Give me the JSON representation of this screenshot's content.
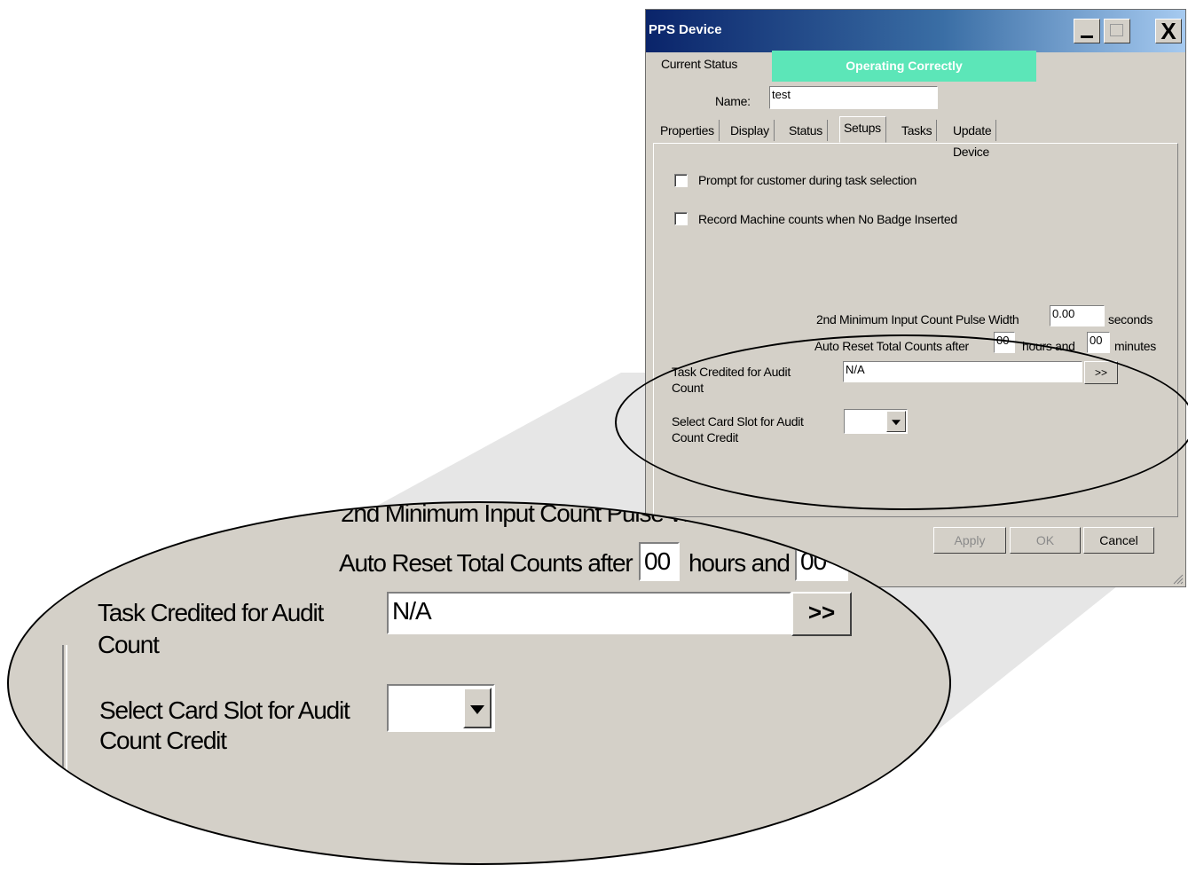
{
  "window": {
    "title": "PPS Device",
    "close_glyph": "X"
  },
  "status": {
    "label": "Current Status",
    "value": "Operating Correctly",
    "color": "#5ce6b8"
  },
  "name_field": {
    "label": "Name:",
    "value": "test"
  },
  "tabs": [
    "Properties",
    "Display",
    "Status",
    "Setups",
    "Tasks",
    "Update Device"
  ],
  "active_tab": "Setups",
  "setups": {
    "checkbox1": "Prompt for customer during task selection",
    "checkbox2": "Record Machine counts when No Badge Inserted",
    "pulse_label": "2nd Minimum Input Count Pulse Width",
    "pulse_value": "0.00",
    "pulse_unit": "seconds",
    "auto_reset_label": "Auto Reset Total Counts after",
    "hours_value": "00",
    "hours_label": "hours and",
    "minutes_value": "00",
    "minutes_label": "minutes",
    "task_label_line1": "Task Credited for Audit",
    "task_label_line2": "Count",
    "task_value": "N/A",
    "browse_label": ">>",
    "slot_label_line1": "Select Card Slot for Audit",
    "slot_label_line2": "Count Credit"
  },
  "buttons": {
    "apply": "Apply",
    "ok": "OK",
    "cancel": "Cancel"
  },
  "zoom": {
    "pulse_label_partial": "2nd Minimum Input Count Pulse W",
    "hours_value_partial": "00"
  }
}
